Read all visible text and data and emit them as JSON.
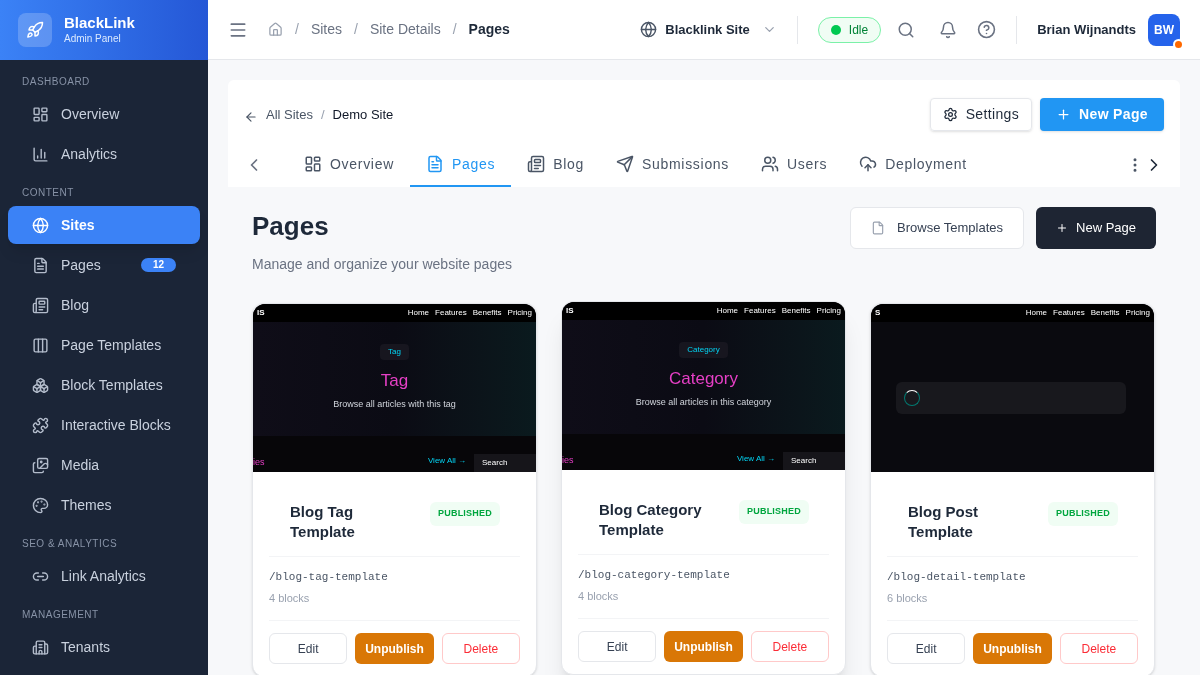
{
  "brand": {
    "name": "BlackLink",
    "subtitle": "Admin Panel"
  },
  "sidebar": {
    "sections": [
      {
        "heading": "DASHBOARD",
        "items": [
          {
            "label": "Overview",
            "selected": false
          },
          {
            "label": "Analytics",
            "selected": false
          }
        ]
      },
      {
        "heading": "CONTENT",
        "items": [
          {
            "label": "Sites",
            "selected": true
          },
          {
            "label": "Pages",
            "selected": false,
            "badge": "12"
          },
          {
            "label": "Blog",
            "selected": false
          },
          {
            "label": "Page Templates",
            "selected": false
          },
          {
            "label": "Block Templates",
            "selected": false
          },
          {
            "label": "Interactive Blocks",
            "selected": false
          },
          {
            "label": "Media",
            "selected": false
          },
          {
            "label": "Themes",
            "selected": false
          }
        ]
      },
      {
        "heading": "SEO & ANALYTICS",
        "items": [
          {
            "label": "Link Analytics",
            "selected": false
          }
        ]
      },
      {
        "heading": "MANAGEMENT",
        "items": [
          {
            "label": "Tenants",
            "selected": false
          }
        ]
      }
    ]
  },
  "header": {
    "separator": "/",
    "breadcrumb": [
      "Sites",
      "Site Details",
      "Pages"
    ],
    "site_selector": "Blacklink Site",
    "status": "Idle",
    "user": "Brian Wijnandts",
    "avatar": "BW"
  },
  "site_bar": {
    "separator": "/",
    "breadcrumb": [
      "All Sites",
      "Demo Site"
    ],
    "buttons": [
      "Settings",
      "New Page"
    ]
  },
  "tabs": [
    {
      "label": "Overview",
      "selected": false
    },
    {
      "label": "Pages",
      "selected": true
    },
    {
      "label": "Blog",
      "selected": false
    },
    {
      "label": "Submissions",
      "selected": false
    },
    {
      "label": "Users",
      "selected": false
    },
    {
      "label": "Deployment",
      "selected": false
    }
  ],
  "page": {
    "title": "Pages",
    "subtitle": "Manage and organize your website pages",
    "buttons": [
      "Browse Templates",
      "New Page"
    ]
  },
  "cards": [
    {
      "title": "Blog Tag Template",
      "status": "PUBLISHED",
      "path": "/blog-tag-template",
      "blocks": "4 blocks",
      "hovered": false,
      "actions": [
        "Edit",
        "Unpublish",
        "Delete"
      ],
      "preview": {
        "kind": "hero",
        "logo": "IS",
        "nav": [
          "Home",
          "Features",
          "Benefits",
          "Pricing"
        ],
        "chip": "Tag",
        "heading": "Tag",
        "subtitle": "Browse all articles with this tag",
        "section": "ies",
        "link": "View All →",
        "search": "Search"
      }
    },
    {
      "title": "Blog Category Template",
      "status": "PUBLISHED",
      "path": "/blog-category-template",
      "blocks": "4 blocks",
      "hovered": true,
      "actions": [
        "Edit",
        "Unpublish",
        "Delete"
      ],
      "preview": {
        "kind": "hero",
        "logo": "IS",
        "nav": [
          "Home",
          "Features",
          "Benefits",
          "Pricing"
        ],
        "chip": "Category",
        "heading": "Category",
        "subtitle": "Browse all articles in this category",
        "section": "ies",
        "link": "View All →",
        "search": "Search"
      }
    },
    {
      "title": "Blog Post Template",
      "status": "PUBLISHED",
      "path": "/blog-detail-template",
      "blocks": "6 blocks",
      "hovered": false,
      "actions": [
        "Edit",
        "Unpublish",
        "Delete"
      ],
      "preview": {
        "kind": "article",
        "logo": "S",
        "nav": [
          "Home",
          "Features",
          "Benefits",
          "Pricing"
        ]
      }
    }
  ]
}
